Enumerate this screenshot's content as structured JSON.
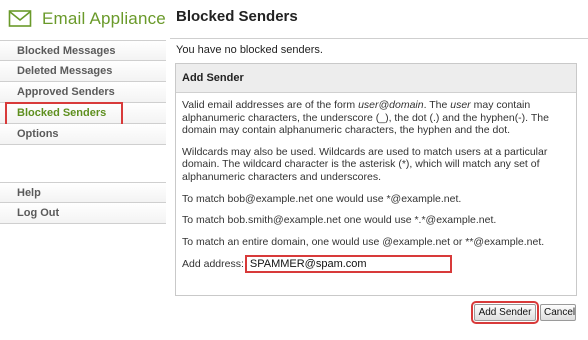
{
  "app": {
    "name": "Email Appliance"
  },
  "sidebar": {
    "items": [
      {
        "label": "Blocked Messages"
      },
      {
        "label": "Deleted Messages"
      },
      {
        "label": "Approved Senders"
      },
      {
        "label": "Blocked Senders",
        "active": true
      },
      {
        "label": "Options"
      }
    ],
    "bottom_items": [
      {
        "label": "Help"
      },
      {
        "label": "Log Out"
      }
    ]
  },
  "main": {
    "title": "Blocked Senders",
    "status": "You have no blocked senders.",
    "panel": {
      "title": "Add Sender",
      "paragraph1": {
        "t1": "Valid email addresses are of the form ",
        "em1": "user@domain",
        "t2": ". The ",
        "em2": "user",
        "t3": " may contain alphanumeric characters, the underscore (_), the dot (.) and the hyphen(-). The domain may contain alphanumeric characters, the hyphen and the dot."
      },
      "paragraph2": "Wildcards may also be used. Wildcards are used to match users at a particular domain. The wildcard character is the asterisk (*), which will match any set of alphanumeric characters and underscores.",
      "example1": "To match bob@example.net one would use *@example.net.",
      "example2": "To match bob.smith@example.net one would use *.*@example.net.",
      "example3": "To match an entire domain, one would use @example.net or **@example.net.",
      "add_label": "Add address:",
      "add_value": "SPAMMER@spam.com"
    },
    "buttons": {
      "add": "Add Sender",
      "cancel": "Cancel"
    }
  },
  "colors": {
    "brand_green": "#6a9a2a",
    "active_nav": "#5e8f1f",
    "highlight_red": "#d83a3a"
  },
  "icons": {
    "logo": "envelope-icon"
  }
}
